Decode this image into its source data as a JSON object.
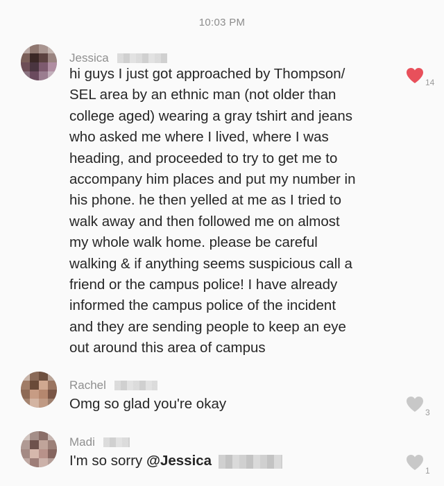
{
  "timestamp": "10:03 PM",
  "messages": [
    {
      "sender": "Jessica",
      "text": "hi guys I just got approached by Thompson/\nSEL area by an ethnic man (not older than\ncollege aged) wearing a gray tshirt and jeans\nwho asked me where I lived, where I was\nheading, and proceeded to try to get me to\naccompany him places and put my number in\nhis phone. he then yelled at me as I tried to\nwalk away and then followed me on almost\nmy whole walk home. please be careful\nwalking & if anything seems suspicious call a\nfriend or the campus police! I have already\ninformed the campus police of the incident\nand they are sending people to keep an eye\nout around this area of campus",
      "like_count": "14",
      "liked": true,
      "heart_color": "#e8505b"
    },
    {
      "sender": "Rachel",
      "text": "Omg so glad you're okay",
      "like_count": "3",
      "liked": false,
      "heart_color": "#c8c8c8"
    },
    {
      "sender": "Madi",
      "text_prefix": "I'm so sorry ",
      "mention": "@Jessica",
      "like_count": "1",
      "liked": false,
      "heart_color": "#c8c8c8"
    }
  ]
}
